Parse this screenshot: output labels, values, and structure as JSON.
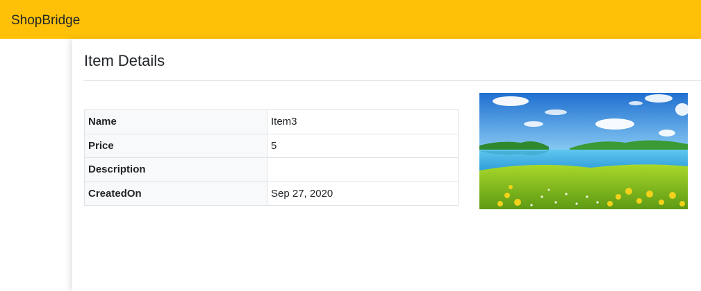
{
  "navbar": {
    "brand": "ShopBridge",
    "color": "#ffc107"
  },
  "page": {
    "title": "Item Details"
  },
  "details": {
    "rows": [
      {
        "label": "Name",
        "value": "Item3"
      },
      {
        "label": "Price",
        "value": "5"
      },
      {
        "label": "Description",
        "value": ""
      },
      {
        "label": "CreatedOn",
        "value": "Sep 27, 2020"
      }
    ]
  },
  "image": {
    "subject": "landscape-photo"
  }
}
